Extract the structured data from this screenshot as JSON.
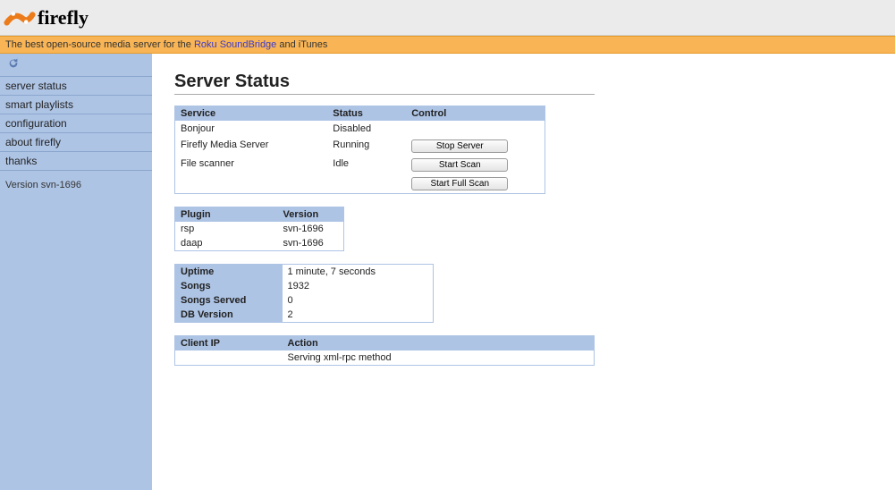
{
  "logo_text": "firefly",
  "tagline_prefix": "The best open-source media server for the ",
  "tagline_link": "Roku SoundBridge",
  "tagline_suffix": " and iTunes",
  "nav": [
    "server status",
    "smart playlists",
    "configuration",
    "about firefly",
    "thanks"
  ],
  "version": "Version svn-1696",
  "page_title": "Server Status",
  "services": {
    "headers": [
      "Service",
      "Status",
      "Control"
    ],
    "rows": [
      {
        "name": "Bonjour",
        "status": "Disabled",
        "buttons": []
      },
      {
        "name": "Firefly Media Server",
        "status": "Running",
        "buttons": [
          "Stop Server"
        ]
      },
      {
        "name": "File scanner",
        "status": "Idle",
        "buttons": [
          "Start Scan",
          "Start Full Scan"
        ]
      }
    ]
  },
  "plugins": {
    "headers": [
      "Plugin",
      "Version"
    ],
    "rows": [
      {
        "name": "rsp",
        "ver": "svn-1696"
      },
      {
        "name": "daap",
        "ver": "svn-1696"
      }
    ]
  },
  "stats": [
    {
      "label": "Uptime",
      "value": "1 minute, 7 seconds"
    },
    {
      "label": "Songs",
      "value": "1932"
    },
    {
      "label": "Songs Served",
      "value": "0"
    },
    {
      "label": "DB Version",
      "value": "2"
    }
  ],
  "clients": {
    "headers": [
      "Client IP",
      "Action"
    ],
    "rows": [
      {
        "ip": "",
        "action": "Serving xml-rpc method"
      }
    ]
  }
}
